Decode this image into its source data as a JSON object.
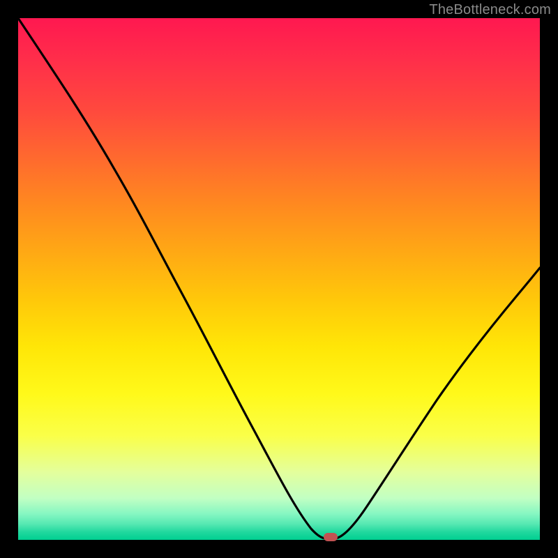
{
  "watermark": "TheBottleneck.com",
  "chart_data": {
    "type": "line",
    "title": "",
    "xlabel": "",
    "ylabel": "",
    "xlim": [
      0,
      100
    ],
    "ylim": [
      0,
      100
    ],
    "x": [
      0,
      5,
      10,
      15,
      20,
      25,
      30,
      35,
      40,
      45,
      50,
      55,
      57,
      59,
      61,
      65,
      70,
      75,
      80,
      85,
      90,
      95,
      100
    ],
    "values": [
      100,
      93,
      85,
      77,
      68,
      59,
      49,
      39,
      29,
      19,
      9,
      1.5,
      0.5,
      0,
      0.5,
      4,
      11,
      19,
      27,
      35,
      42,
      49,
      55
    ],
    "marker": {
      "x": 59,
      "y": 0
    },
    "gradient_colors": {
      "top": "#ff1850",
      "mid": "#ffe607",
      "bottom": "#00cf91"
    }
  }
}
